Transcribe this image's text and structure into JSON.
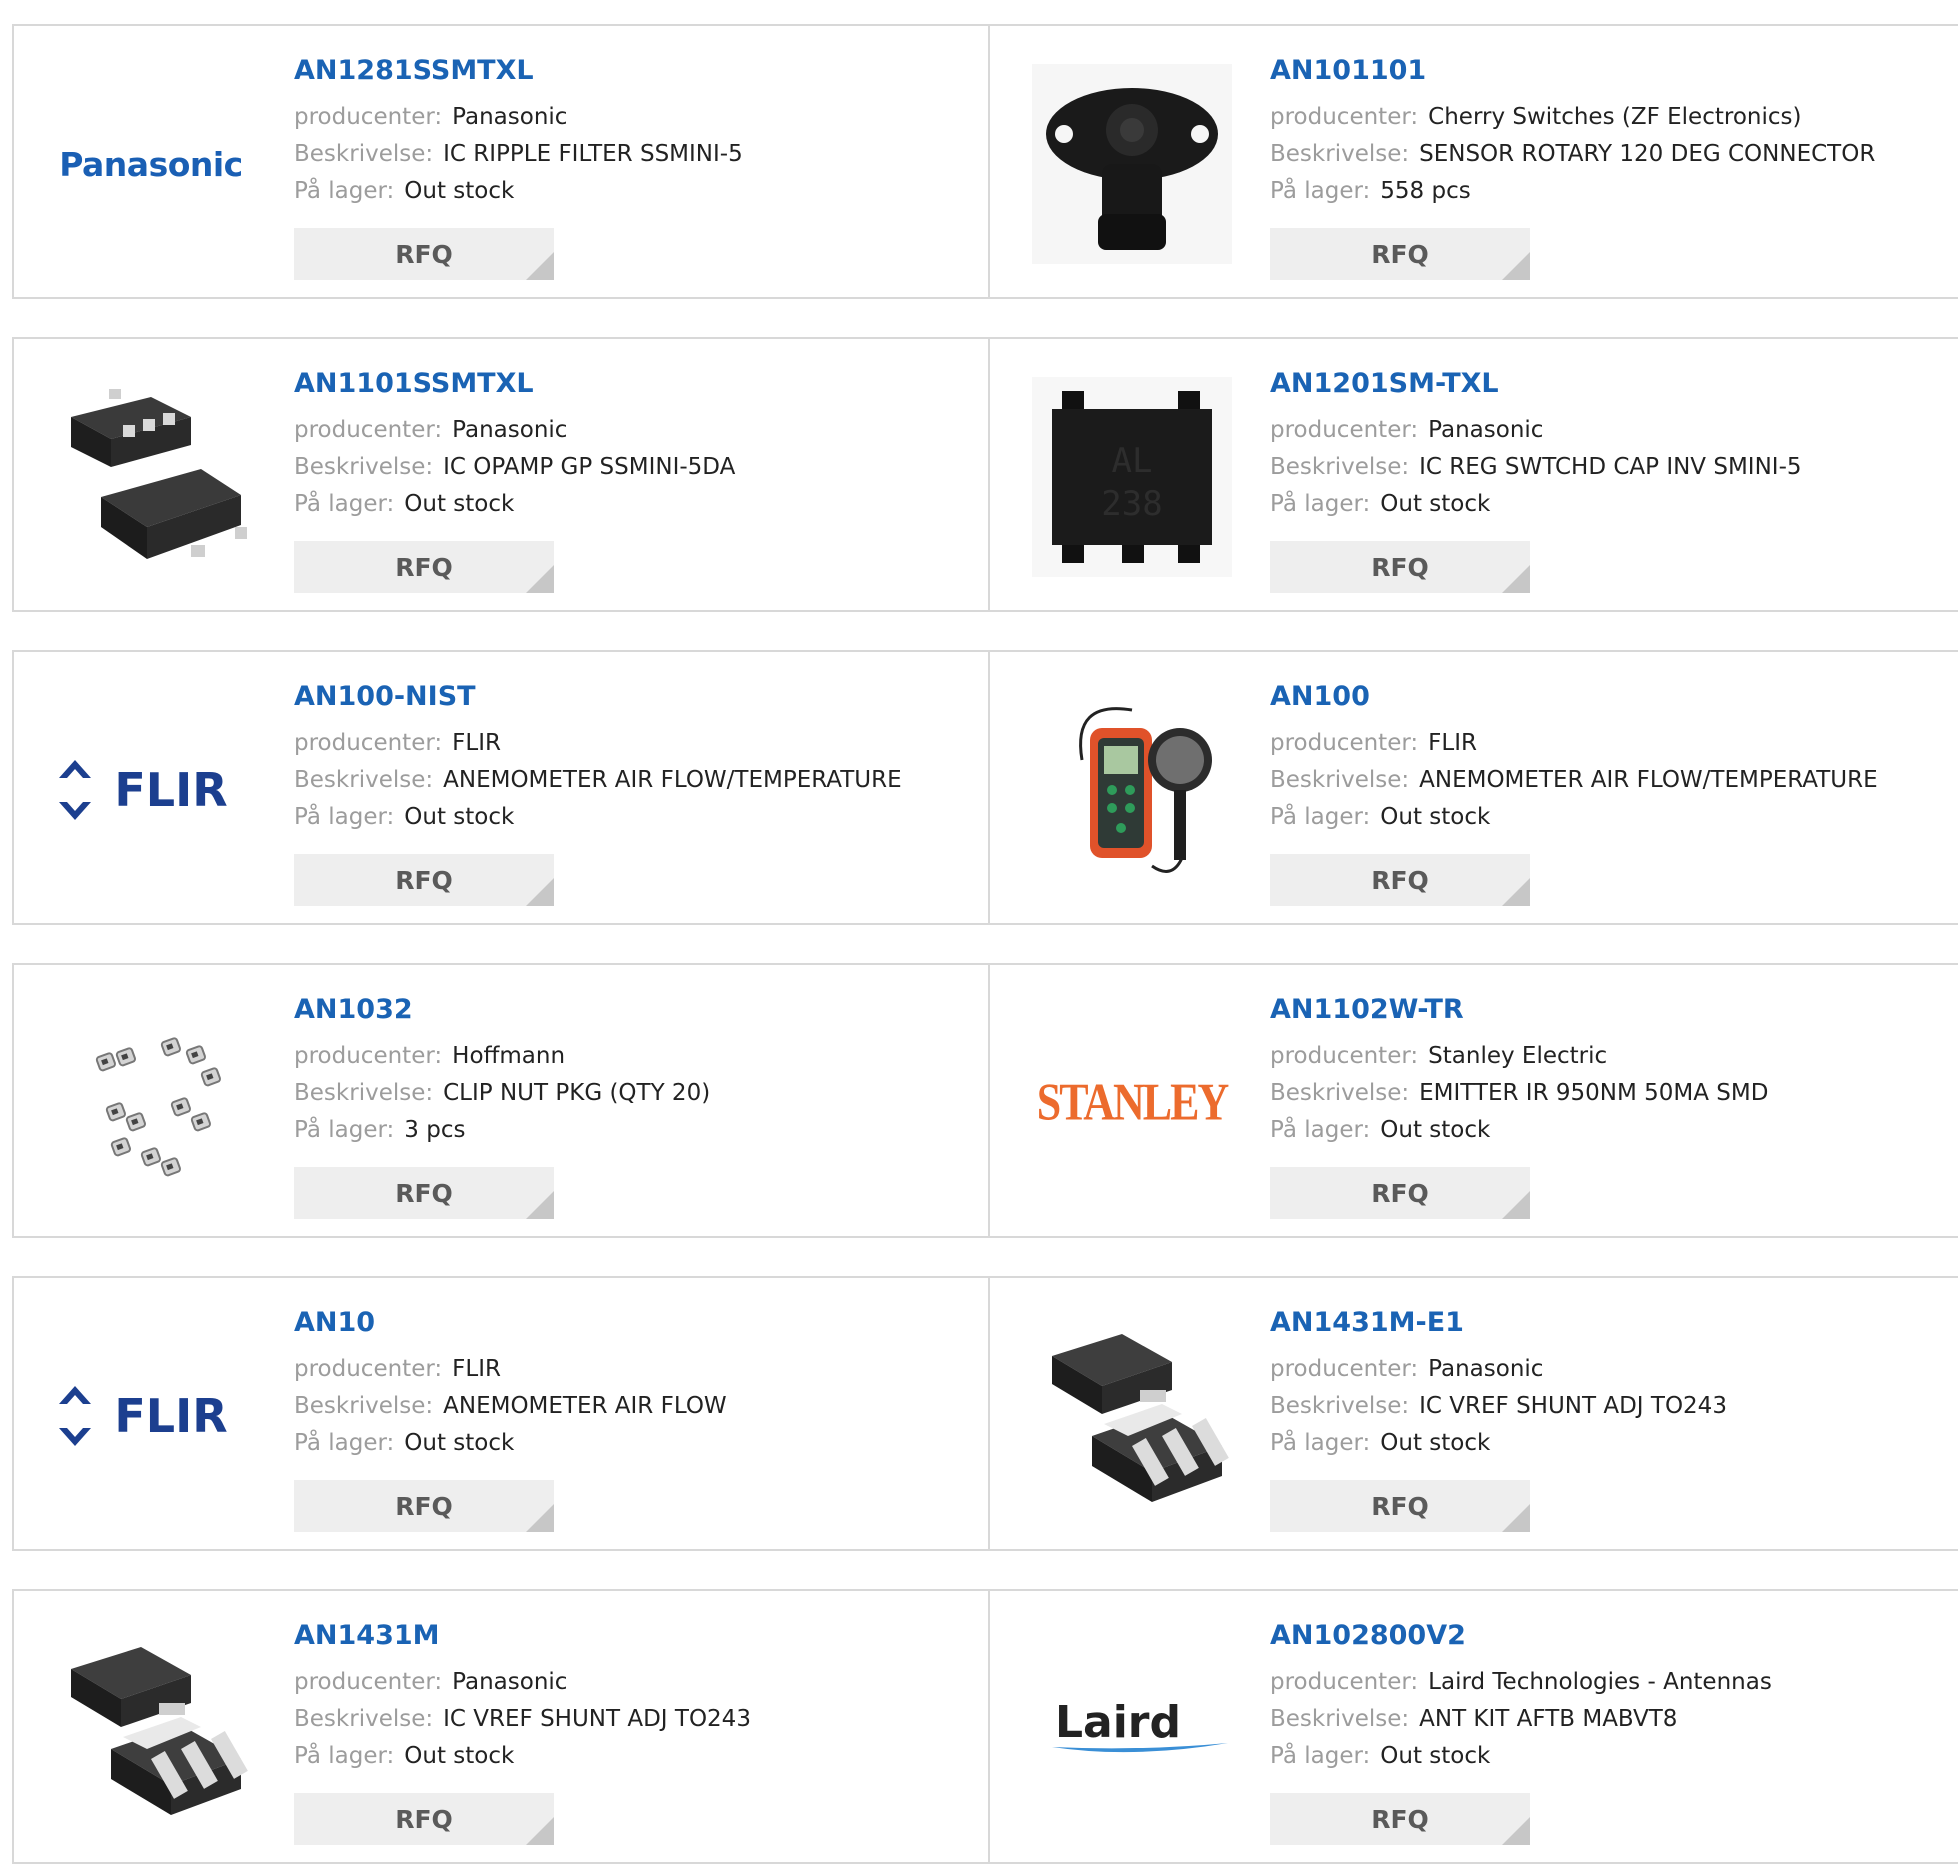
{
  "labels": {
    "manufacturer": "producenter:",
    "description": "Beskrivelse:",
    "stock": "På lager:",
    "rfq": "RFQ"
  },
  "products": [
    {
      "part": "AN1281SSMTXL",
      "manufacturer": "Panasonic",
      "description": "IC RIPPLE FILTER SSMINI-5",
      "stock": "Out stock",
      "image": "panasonic-logo",
      "logo_text": "Panasonic"
    },
    {
      "part": "AN101101",
      "manufacturer": "Cherry Switches (ZF Electronics)",
      "description": "SENSOR ROTARY 120 DEG CONNECTOR",
      "stock": "558 pcs",
      "image": "rotary-sensor-photo"
    },
    {
      "part": "AN1101SSMTXL",
      "manufacturer": "Panasonic",
      "description": "IC OPAMP GP SSMINI-5DA",
      "stock": "Out stock",
      "image": "ic-package-photo"
    },
    {
      "part": "AN1201SM-TXL",
      "manufacturer": "Panasonic",
      "description": "IC REG SWTCHD CAP INV SMINI-5",
      "stock": "Out stock",
      "image": "ic-chip-photo"
    },
    {
      "part": "AN100-NIST",
      "manufacturer": "FLIR",
      "description": "ANEMOMETER AIR FLOW/TEMPERATURE",
      "stock": "Out stock",
      "image": "flir-logo",
      "logo_text": "FLIR"
    },
    {
      "part": "AN100",
      "manufacturer": "FLIR",
      "description": "ANEMOMETER AIR FLOW/TEMPERATURE",
      "stock": "Out stock",
      "image": "anemometer-photo"
    },
    {
      "part": "AN1032",
      "manufacturer": "Hoffmann",
      "description": "CLIP NUT PKG (QTY 20)",
      "stock": "3 pcs",
      "image": "clip-nuts-photo"
    },
    {
      "part": "AN1102W-TR",
      "manufacturer": "Stanley Electric",
      "description": "EMITTER IR 950NM 50MA SMD",
      "stock": "Out stock",
      "image": "stanley-logo",
      "logo_text": "STANLEY"
    },
    {
      "part": "AN10",
      "manufacturer": "FLIR",
      "description": "ANEMOMETER AIR FLOW",
      "stock": "Out stock",
      "image": "flir-logo",
      "logo_text": "FLIR"
    },
    {
      "part": "AN1431M-E1",
      "manufacturer": "Panasonic",
      "description": "IC VREF SHUNT ADJ TO243",
      "stock": "Out stock",
      "image": "sot89-package-photo"
    },
    {
      "part": "AN1431M",
      "manufacturer": "Panasonic",
      "description": "IC VREF SHUNT ADJ TO243",
      "stock": "Out stock",
      "image": "sot89-package-photo"
    },
    {
      "part": "AN102800V2",
      "manufacturer": "Laird Technologies - Antennas",
      "description": "ANT KIT AFTB MABVT8",
      "stock": "Out stock",
      "image": "laird-logo",
      "logo_text": "Laird"
    }
  ]
}
